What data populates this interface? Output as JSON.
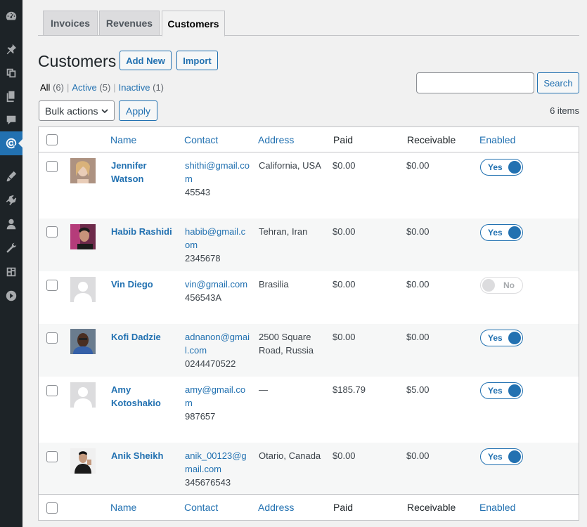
{
  "tabs": [
    {
      "label": "Invoices"
    },
    {
      "label": "Revenues"
    },
    {
      "label": "Customers"
    }
  ],
  "page": {
    "title": "Customers",
    "add_new_label": "Add New",
    "import_label": "Import"
  },
  "filters": {
    "all_label": "All",
    "all_count": "(6)",
    "active_label": "Active",
    "active_count": "(5)",
    "inactive_label": "Inactive",
    "inactive_count": "(1)",
    "separator": "|"
  },
  "search": {
    "button_label": "Search",
    "value": ""
  },
  "bulk": {
    "select_value": "Bulk actions",
    "apply_label": "Apply"
  },
  "items_count": "6 items",
  "columns": {
    "name": "Name",
    "contact": "Contact",
    "address": "Address",
    "paid": "Paid",
    "receivable": "Receivable",
    "enabled": "Enabled"
  },
  "customers": [
    {
      "name": "Jennifer Watson",
      "email": "shithi@gmail.com",
      "phone": "45543",
      "address": "California, USA",
      "paid": "$0.00",
      "receivable": "$0.00",
      "enabled": true,
      "toggle_label": "Yes",
      "avatar": "photo"
    },
    {
      "name": "Habib Rashidi",
      "email": "habib@gmail.com",
      "phone": "2345678",
      "address": "Tehran, Iran",
      "paid": "$0.00",
      "receivable": "$0.00",
      "enabled": true,
      "toggle_label": "Yes",
      "avatar": "photo"
    },
    {
      "name": "Vin Diego",
      "email": "vin@gmail.com",
      "phone": "456543A",
      "address": "Brasilia",
      "paid": "$0.00",
      "receivable": "$0.00",
      "enabled": false,
      "toggle_label": "No",
      "avatar": "placeholder"
    },
    {
      "name": "Kofi Dadzie",
      "email": "adnanon@gmail.com",
      "phone": "0244470522",
      "address": "2500 Square Road, Russia",
      "paid": "$0.00",
      "receivable": "$0.00",
      "enabled": true,
      "toggle_label": "Yes",
      "avatar": "photo"
    },
    {
      "name": "Amy Kotoshakio",
      "email": "amy@gmail.com",
      "phone": "987657",
      "address": "—",
      "paid": "$185.79",
      "receivable": "$5.00",
      "enabled": true,
      "toggle_label": "Yes",
      "avatar": "placeholder"
    },
    {
      "name": "Anik Sheikh",
      "email": "anik_00123@gmail.com",
      "phone": "345676543",
      "address": "Otario, Canada",
      "paid": "$0.00",
      "receivable": "$0.00",
      "enabled": true,
      "toggle_label": "Yes",
      "avatar": "photo"
    }
  ],
  "sidebar": {
    "items": [
      {
        "icon": "dashboard-icon"
      },
      {
        "icon": "pin-icon"
      },
      {
        "icon": "media-icon"
      },
      {
        "icon": "pages-icon"
      },
      {
        "icon": "comments-icon"
      },
      {
        "icon": "ever-accounting-icon",
        "active": true
      },
      {
        "icon": "appearance-icon"
      },
      {
        "icon": "plugins-icon"
      },
      {
        "icon": "users-icon"
      },
      {
        "icon": "tools-icon"
      },
      {
        "icon": "settings-icon"
      },
      {
        "icon": "collapse-icon"
      }
    ]
  },
  "colors": {
    "accent": "#2271b1",
    "sidebar_bg": "#1d2327",
    "page_bg": "#f1f1f1"
  }
}
